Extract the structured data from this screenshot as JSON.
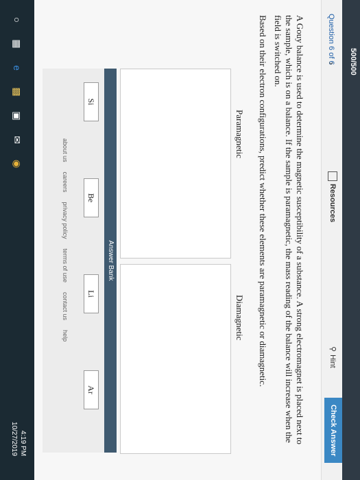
{
  "header": {
    "score": "500/500",
    "question_counter": "Question 6 of 6",
    "resources_label": "Resources",
    "hint_label": "Hint",
    "check_answer_label": "Check Answer"
  },
  "question": {
    "text": "A Gouy balance is used to determine the magnetic susceptibility of a substance. A strong electromagnet is placed next to the sample, which is on a balance. If the sample is paramagnetic, the mass reading of the balance will increase when the field is switched on.",
    "prompt": "Based on their electron configurations, predict whether these elements are paramagnetic or diamagnetic."
  },
  "zones": {
    "left_label": "Paramagnetic",
    "right_label": "Diamagnetic"
  },
  "answer_bank": {
    "title": "Answer Bank",
    "items": [
      "Si",
      "Be",
      "Li",
      "Ar"
    ]
  },
  "footer": {
    "links": [
      "about us",
      "careers",
      "privacy policy",
      "terms of use",
      "contact us",
      "help"
    ]
  },
  "taskbar": {
    "time": "4:19 PM",
    "date": "10/27/2019"
  }
}
